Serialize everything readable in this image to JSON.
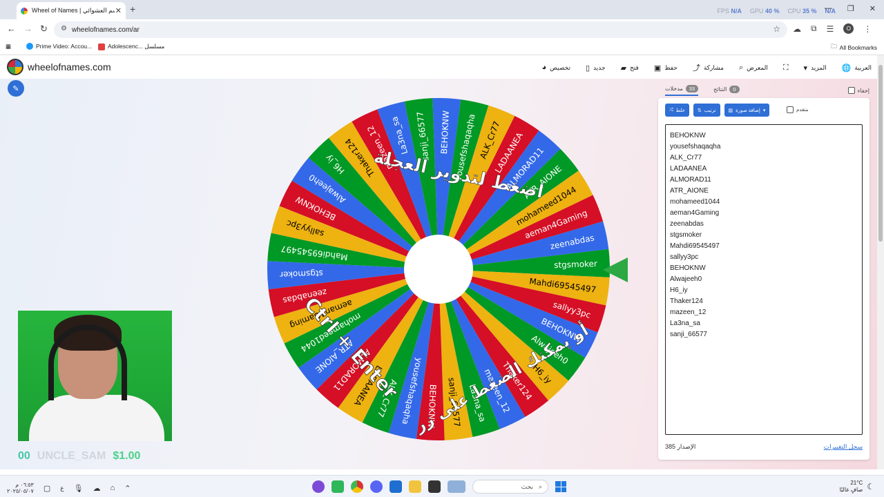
{
  "browser": {
    "tab_title": "Wheel of Names | عجلة الاسم العشوائي",
    "tab_close": "✕",
    "new_tab": "+",
    "url": "wheelofnames.com/ar",
    "stats": {
      "fps_label": "FPS",
      "fps_value": "N/A",
      "gpu_label": "GPU",
      "gpu_value": "40 %",
      "cpu_label": "CPU",
      "cpu_value": "35 %",
      "extra": "N/A"
    },
    "profile_initial": "O",
    "bookmarks": [
      {
        "label": "Prime Video: Accou...",
        "icon_color": "#1a98ff"
      },
      {
        "label": "Adolescenc... مسلسل",
        "icon_color": "#e04040"
      }
    ],
    "all_bookmarks": "All Bookmarks"
  },
  "site": {
    "logo_text": "wheelofnames.com",
    "menu": [
      {
        "label": "العربية",
        "icon": "globe-icon",
        "glyph": "🌐"
      },
      {
        "label": "المزيد",
        "icon": "chevron-down-icon",
        "glyph": "▾"
      },
      {
        "label": "",
        "icon": "fullscreen-icon",
        "glyph": "⛶"
      },
      {
        "label": "المعرض",
        "icon": "search-icon",
        "glyph": "🔍"
      },
      {
        "label": "مشاركة",
        "icon": "share-icon",
        "glyph": "⤴"
      },
      {
        "label": "حفظ",
        "icon": "save-icon",
        "glyph": "💾"
      },
      {
        "label": "فتح",
        "icon": "folder-icon",
        "glyph": "📂"
      },
      {
        "label": "جديد",
        "icon": "file-icon",
        "glyph": "📄"
      },
      {
        "label": "تخصيص",
        "icon": "palette-icon",
        "glyph": "🎨"
      }
    ]
  },
  "wheel": {
    "colors": [
      "#3369e8",
      "#009925",
      "#eeb211",
      "#d50f25"
    ],
    "overlay_text_1": "اضغط لتدوير العجلة",
    "overlay_text_2": "أو يمكنك الضغط على زر",
    "overlay_text_3": "Ctrl + Enter",
    "pointer_color": "#2da843"
  },
  "ticker": {
    "a": "00",
    "b": "UNCLE_SAM",
    "c": "$1.00"
  },
  "sidebar": {
    "hide_label": "إخفاء",
    "results_label": "النتائج",
    "results_count": "0",
    "entries_label": "مدخلات",
    "entries_count": "33",
    "shuffle": "خلط",
    "sort": "ترتيب",
    "add_image": "إضافة صورة",
    "advanced": "متقدم",
    "entries": [
      "BEHOKNW",
      "yousefshaqaqha",
      "ALK_Cr77",
      "LADAANEA",
      "ALMORAD11",
      "ATR_AIONE",
      "mohameed1044",
      "aeman4Gaming",
      "zeenabdas",
      "stgsmoker",
      "Mahdi69545497",
      "sallyy3pc",
      "BEHOKNW",
      "Alwajeeh0",
      "H6_iy",
      "Thaker124",
      "mazeen_12",
      "La3na_sa",
      "sanji_66577"
    ],
    "version_label": "الإصدار",
    "version": "385",
    "changelog": "سجل التغييرات"
  },
  "taskbar": {
    "time": "٠٦:٥٣ م",
    "date": "٢٠٢٥/٠٥/٠٧",
    "lang": "ع",
    "search_placeholder": "بحث",
    "weather_temp": "21°C",
    "weather_text": "صافٍ غالبًا"
  }
}
